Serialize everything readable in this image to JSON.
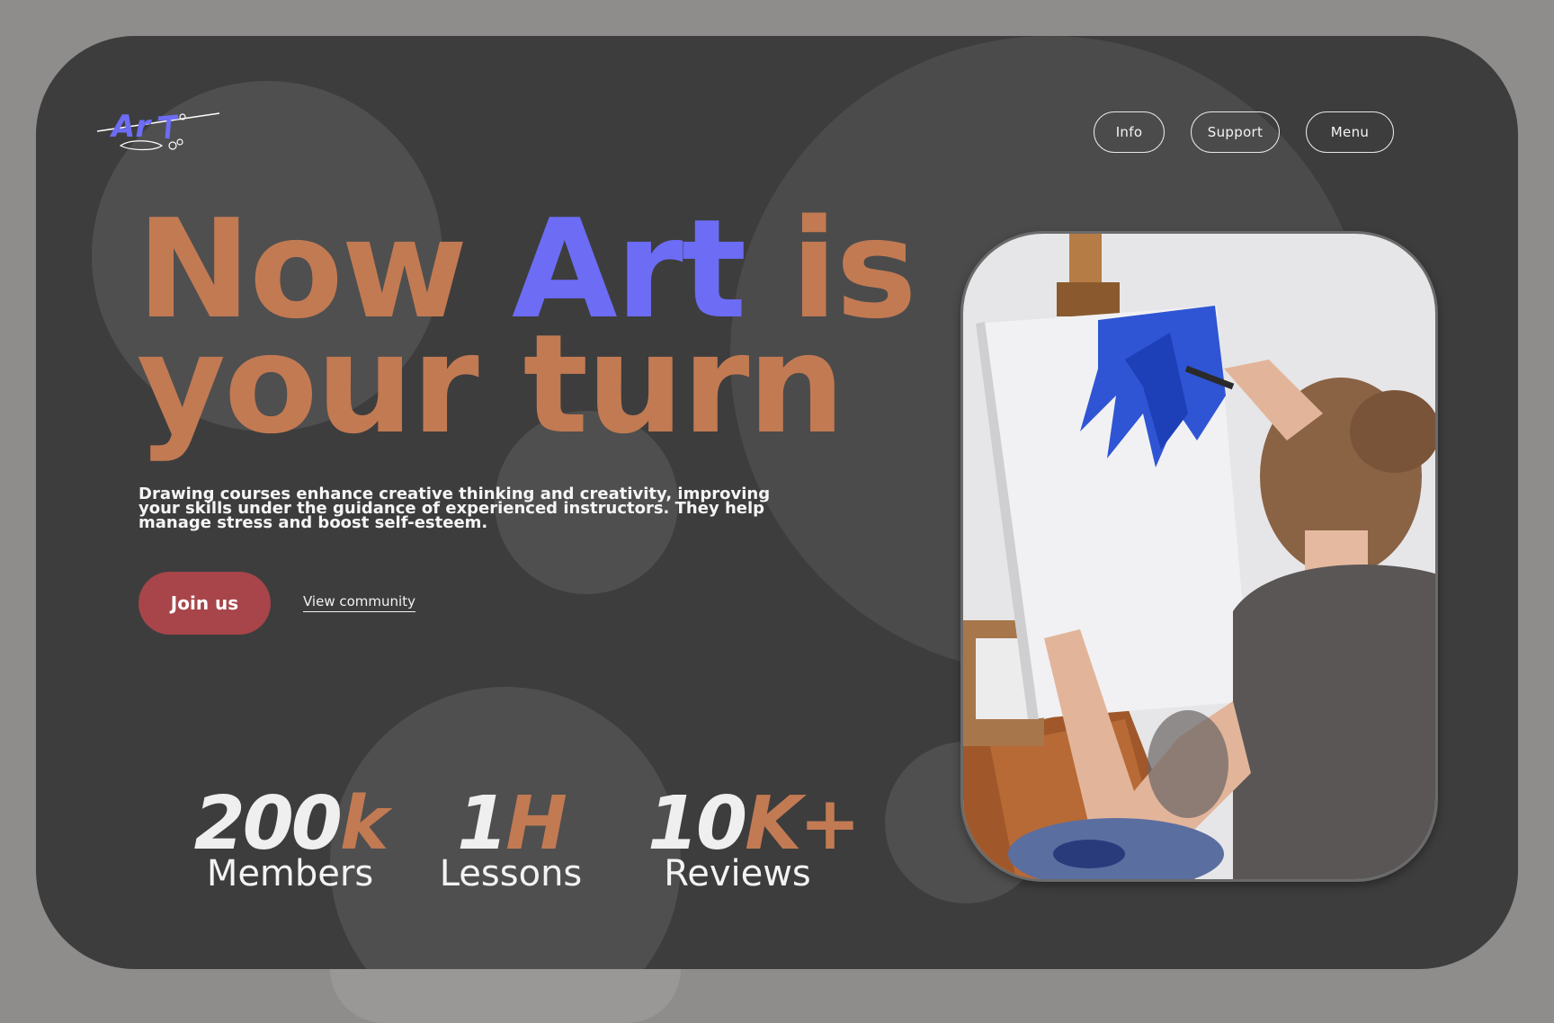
{
  "brand": {
    "logo_text": "Ar",
    "colors": {
      "accent": "#6c6cf5",
      "warm": "#c27a53",
      "cta": "#a7454a",
      "background": "#3d3d3d"
    }
  },
  "nav": {
    "items": [
      "Info",
      "Support",
      "Menu"
    ]
  },
  "hero": {
    "headline_part1": "Now ",
    "headline_accent": "Art",
    "headline_part2": " is",
    "headline_line2": "your turn",
    "description": "Drawing courses enhance creative thinking and creativity, improving your skills under the guidance of experienced instructors. They help manage stress and boost self-esteem.",
    "cta_primary": "Join us",
    "cta_secondary": "View community"
  },
  "stats": [
    {
      "value": "200",
      "unit": "k",
      "label": "Members"
    },
    {
      "value": "1",
      "unit": "H",
      "label": "Lessons"
    },
    {
      "value": "10",
      "unit": "K+",
      "label": "Reviews"
    }
  ],
  "image": {
    "subject": "woman painting blue strokes on canvas at easel"
  }
}
